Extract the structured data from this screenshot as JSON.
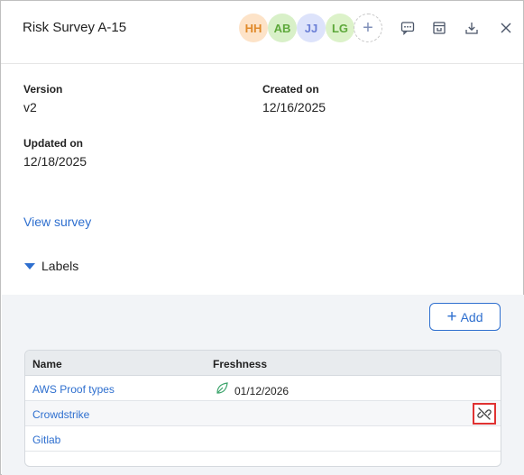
{
  "header": {
    "title": "Risk Survey A-15",
    "avatars": [
      {
        "initials": "HH",
        "bg": "#fde3c8",
        "color": "#e08a2a"
      },
      {
        "initials": "AB",
        "bg": "#d8f0c8",
        "color": "#5da83a"
      },
      {
        "initials": "JJ",
        "bg": "#dde3fb",
        "color": "#6b7fd6"
      },
      {
        "initials": "LG",
        "bg": "#dcf2c9",
        "color": "#5da83a"
      }
    ],
    "add_avatar_glyph": "+",
    "icons": [
      "comment-icon",
      "archive-icon",
      "download-icon",
      "close-icon"
    ]
  },
  "info": {
    "version_label": "Version",
    "version_value": "v2",
    "created_label": "Created on",
    "created_value": "12/16/2025",
    "updated_label": "Updated on",
    "updated_value": "12/18/2025"
  },
  "view_survey_link": "View survey",
  "labels_section": {
    "toggle_label": "Labels",
    "add_button": {
      "glyph": "+",
      "label": "Add"
    },
    "table": {
      "columns": [
        "Name",
        "Freshness"
      ],
      "rows": [
        {
          "name": "AWS Proof types",
          "freshness": "01/12/2026"
        },
        {
          "name": "Crowdstrike",
          "freshness": ""
        },
        {
          "name": "Gitlab",
          "freshness": ""
        }
      ]
    }
  },
  "colors": {
    "accent": "#2e6fcf",
    "highlight": "#e03232",
    "fresh_leaf": "#3aa36a"
  }
}
